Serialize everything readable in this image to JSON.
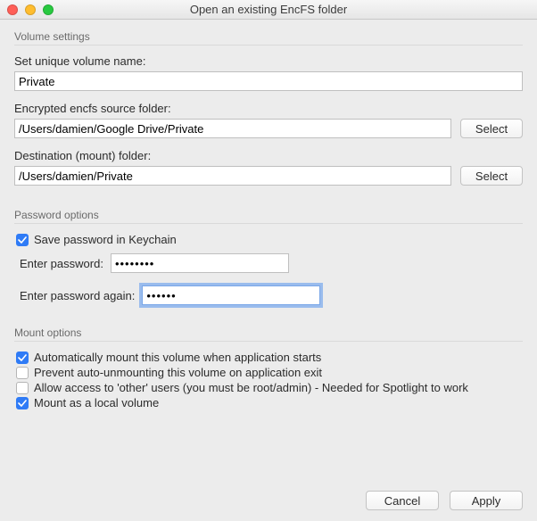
{
  "window": {
    "title": "Open an existing EncFS folder"
  },
  "volume_settings": {
    "group_label": "Volume settings",
    "name_label": "Set unique volume name:",
    "name_value": "Private",
    "source_label": "Encrypted encfs source folder:",
    "source_value": "/Users/damien/Google Drive/Private",
    "select_label": "Select",
    "dest_label": "Destination (mount) folder:",
    "dest_value": "/Users/damien/Private"
  },
  "password_options": {
    "group_label": "Password options",
    "save_keychain_label": "Save password in Keychain",
    "save_keychain_checked": true,
    "enter_label": "Enter password:",
    "enter_value": "••••••••",
    "again_label": "Enter password again:",
    "again_value": "••••••"
  },
  "mount_options": {
    "group_label": "Mount options",
    "items": [
      {
        "label": "Automatically mount this volume when application starts",
        "checked": true
      },
      {
        "label": "Prevent auto-unmounting this volume on application exit",
        "checked": false
      },
      {
        "label": "Allow access to 'other' users (you must be root/admin) - Needed for Spotlight to work",
        "checked": false
      },
      {
        "label": "Mount as a local volume",
        "checked": true
      }
    ]
  },
  "footer": {
    "cancel": "Cancel",
    "apply": "Apply"
  }
}
